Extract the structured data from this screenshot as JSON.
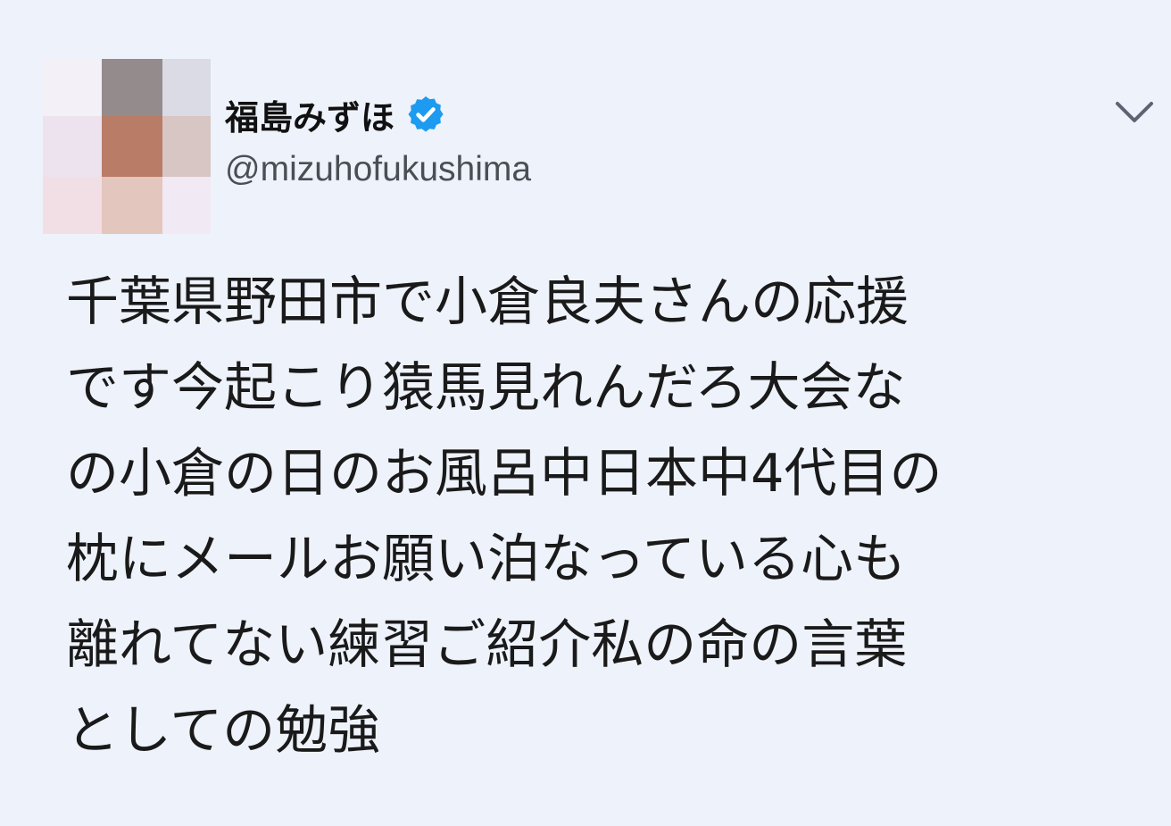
{
  "tweet": {
    "display_name": "福島みずほ",
    "handle": "@mizuhofukushima",
    "verified": true,
    "text": "千葉県野田市で小倉良夫さんの応援\nです今起こり猿馬見れんだろ大会な\nの小倉の日のお風呂中日本中4代目の\n枕にメールお願い泊なっている心も\n離れてない練習ご紹介私の命の言葉\nとしての勉強"
  },
  "icons": {
    "verified": "verified-badge-icon",
    "menu": "chevron-down-icon"
  },
  "avatar_mosaic": [
    "#f3f0f7",
    "#948b8c",
    "#dadbe4",
    "#ece3ee",
    "#b97c66",
    "#d8c6c4",
    "#f1dfe5",
    "#e3c6bd",
    "#f1e9f3"
  ],
  "colors": {
    "background": "#eef2fb",
    "verified_blue": "#1d9bf0",
    "handle_gray": "#4a4f55"
  }
}
